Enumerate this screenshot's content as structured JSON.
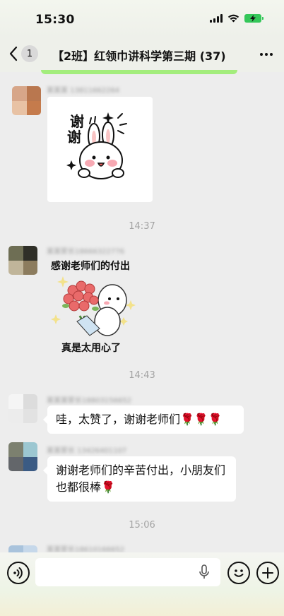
{
  "status": {
    "time": "15:30"
  },
  "header": {
    "unread_count": "1",
    "title": "【2班】红领巾讲科学第三期 (37)"
  },
  "messages": [
    {
      "sender": "某某某 13811662264",
      "type": "sticker",
      "sticker_text_1": "谢",
      "sticker_text_2": "谢"
    },
    {
      "time_divider": "14:37"
    },
    {
      "sender": "某某家长18666322776",
      "type": "sticker",
      "sticker_top": "感谢老师们的付出",
      "sticker_bottom": "真是太用心了"
    },
    {
      "time_divider": "14:43"
    },
    {
      "sender": "某某某家长18803156652",
      "type": "text",
      "text": "哇，太赞了，谢谢老师们🌹🌹🌹"
    },
    {
      "sender": "某某家长 13426401107",
      "type": "text",
      "text": "谢谢老师们的辛苦付出，小朋友们也都很棒🌹"
    },
    {
      "time_divider": "15:06"
    },
    {
      "sender": "某某家长18610166652"
    }
  ],
  "input": {
    "placeholder": "",
    "value": ""
  },
  "colors": {
    "accent_green": "#95ec69",
    "battery_green": "#34c759"
  }
}
